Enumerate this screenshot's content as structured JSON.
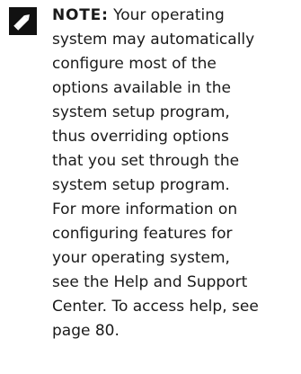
{
  "note": {
    "icon": "pencil-note-icon",
    "label": "NOTE:",
    "lines": [
      " Your operating",
      "system may automatically",
      "configure most of the",
      "options available in the",
      "system setup program,",
      "thus overriding options",
      "that you set through the",
      "system setup program.",
      "For more information on",
      "configuring features for",
      "your operating system,",
      "see the Help and Support",
      "Center. To access help, see",
      "page 80."
    ]
  }
}
